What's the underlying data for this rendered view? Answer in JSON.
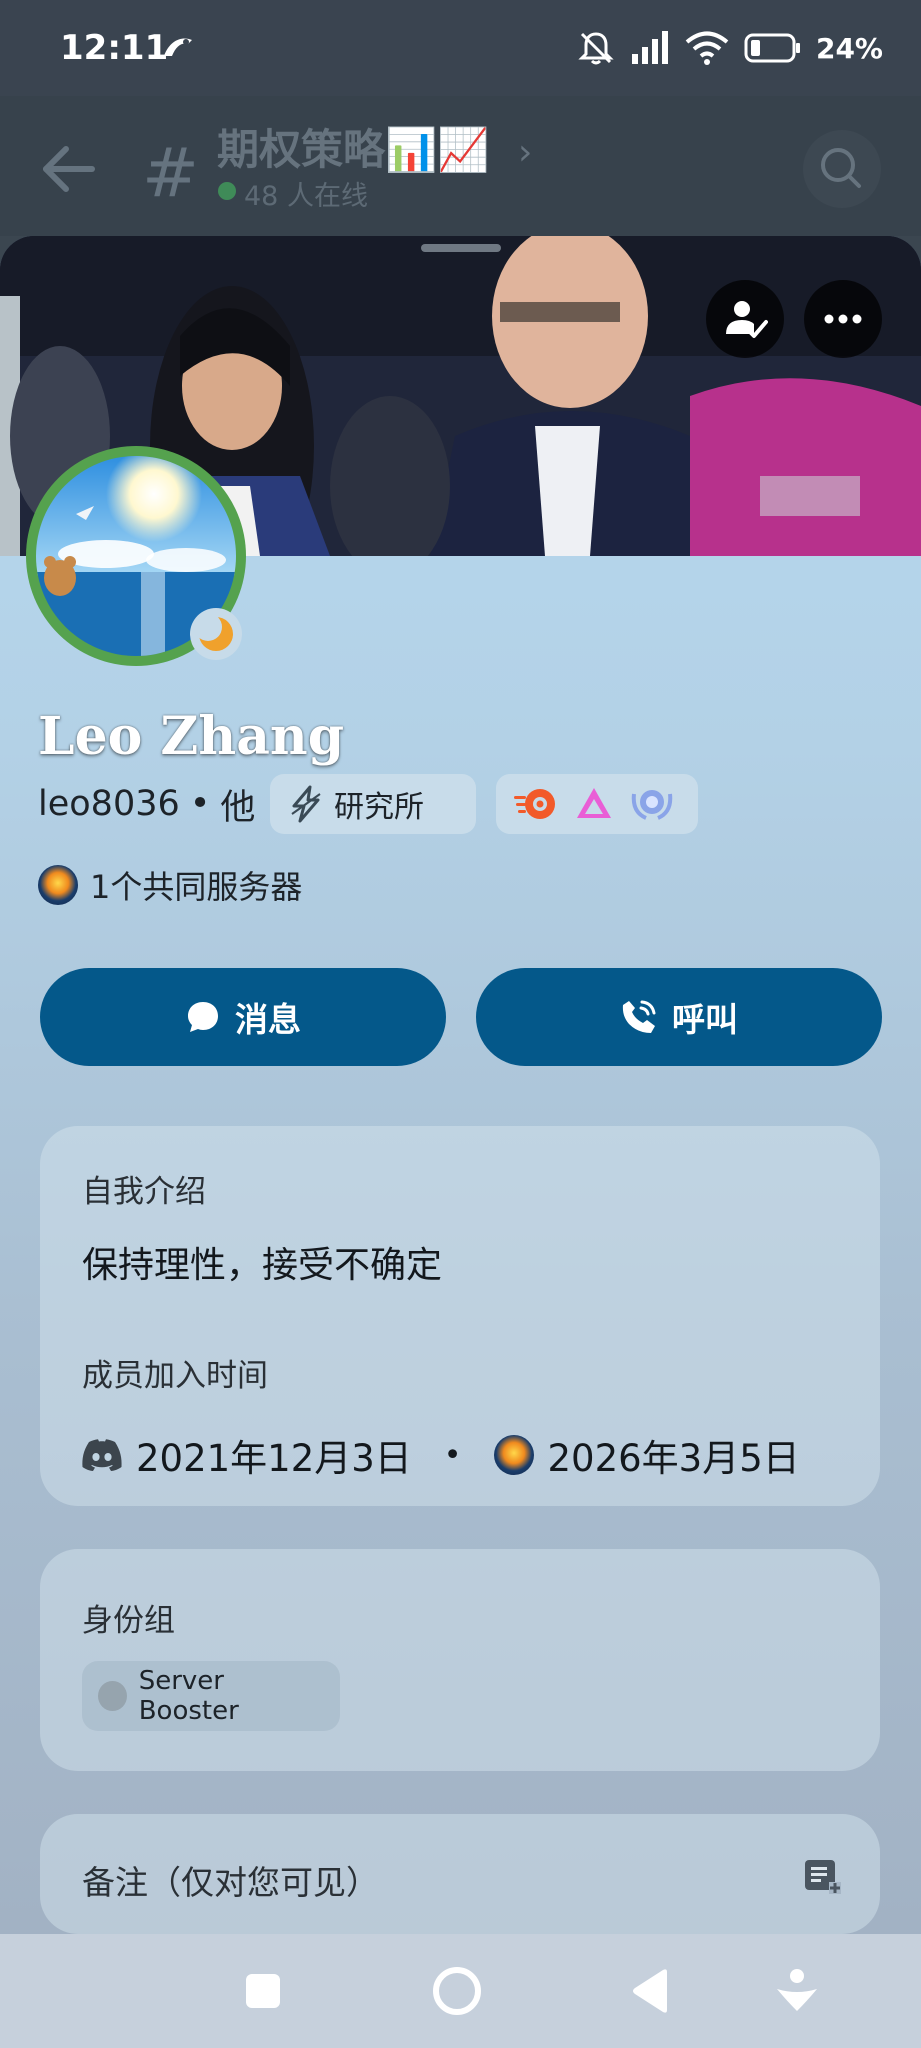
{
  "status_bar": {
    "time": "12:11",
    "battery": "24%"
  },
  "channel": {
    "title": "期权策略📊📈",
    "online": "48 人在线"
  },
  "profile": {
    "display_name": "Leo Zhang",
    "username": "leo8036",
    "separator": "•",
    "pronouns": "他",
    "server_tag": "研究所",
    "mutual_servers": "1个共同服务器"
  },
  "actions": {
    "message": "消息",
    "call": "呼叫"
  },
  "about": {
    "label": "自我介绍",
    "bio": "保持理性，接受不确定",
    "joined_label": "成员加入时间",
    "discord_joined": "2021年12月3日",
    "dot": "•",
    "server_joined": "2026年3月5日"
  },
  "roles": {
    "label": "身份组",
    "items": [
      "Server Booster"
    ]
  },
  "note": {
    "label": "备注（仅对您可见）"
  },
  "colors": {
    "button": "#04588a",
    "online": "#3f8b58",
    "avatar_ring": "#55a24e"
  },
  "icons": [
    "back-arrow-icon",
    "search-icon",
    "friend-check-icon",
    "more-icon",
    "moon-icon",
    "chat-bubble-icon",
    "phone-icon",
    "discord-icon",
    "note-add-icon"
  ]
}
